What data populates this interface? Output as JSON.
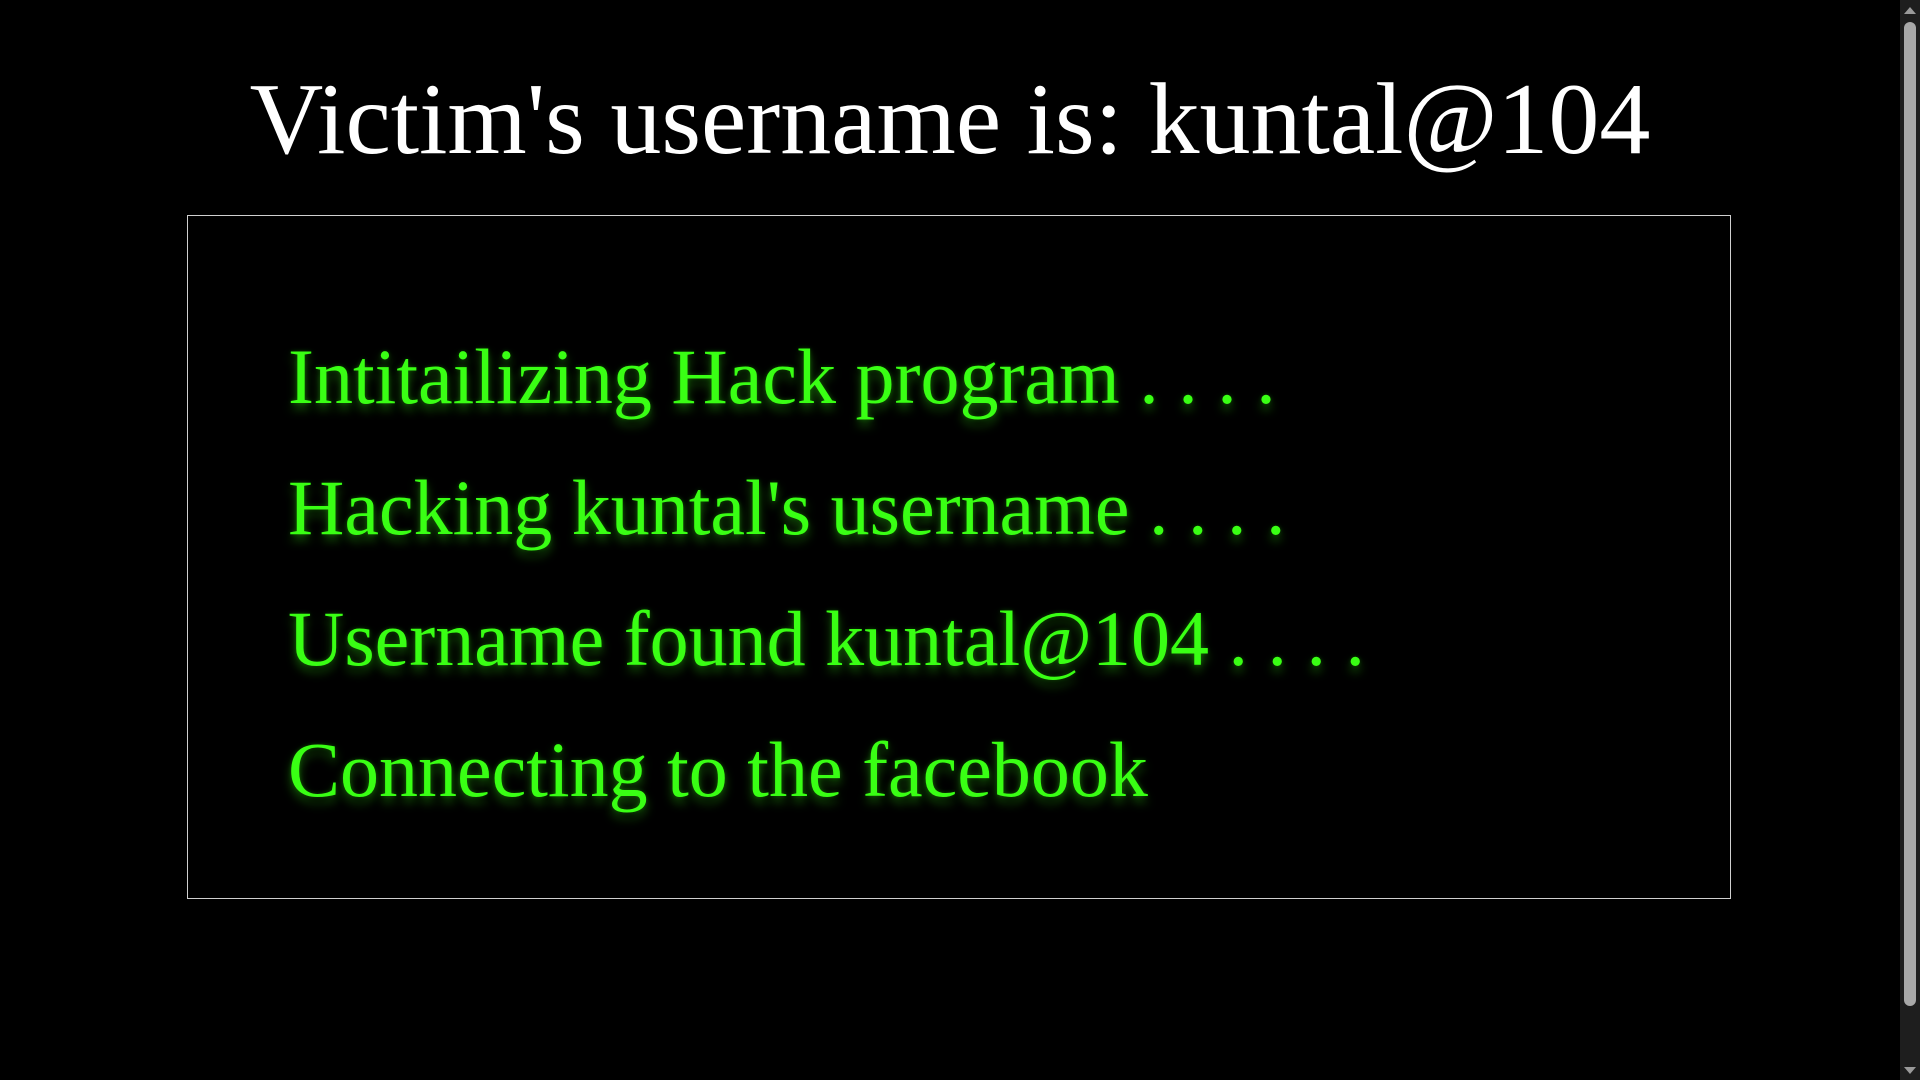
{
  "header": {
    "title": "Victim's username is: kuntal@104"
  },
  "log": {
    "lines": [
      "Intitailizing Hack program . . . .",
      "Hacking kuntal's username . . . .",
      "Username found kuntal@104 . . . .",
      "Connecting to the facebook"
    ]
  },
  "colors": {
    "background": "#000000",
    "title": "#ffffff",
    "log_text": "#39ff14",
    "box_border": "#d0d0d0"
  },
  "scrollbar": {
    "up_icon": "arrow-up-icon",
    "down_icon": "arrow-down-icon"
  }
}
